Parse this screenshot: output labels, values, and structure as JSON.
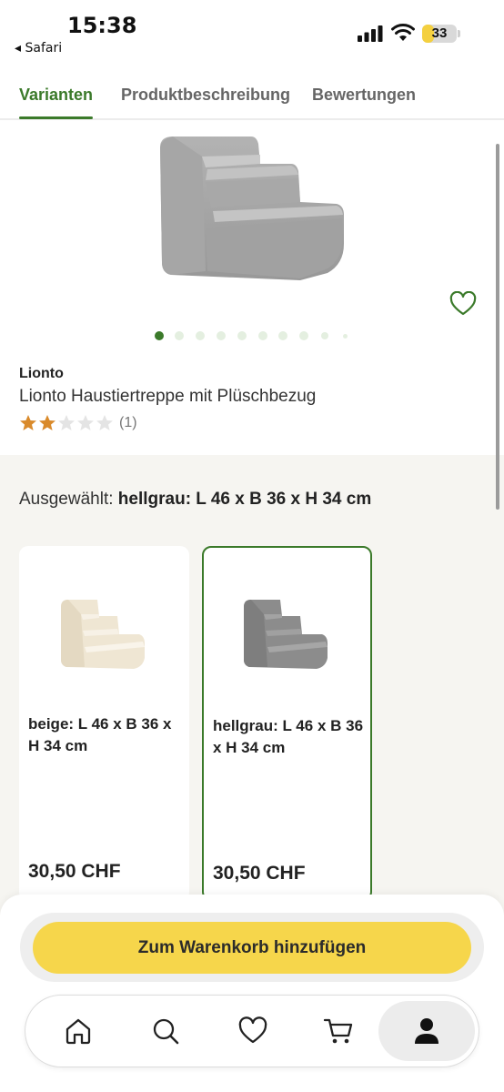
{
  "status_bar": {
    "time": "15:38",
    "back_app": "◂ Safari",
    "battery": "33"
  },
  "tabs": [
    {
      "label": "Varianten",
      "active": true
    },
    {
      "label": "Produktbeschreibung",
      "active": false
    },
    {
      "label": "Bewertungen",
      "active": false
    }
  ],
  "product": {
    "brand": "Lionto",
    "name": "Lionto Haustiertreppe mit Plüschbezug",
    "rating": 2,
    "rating_max": 5,
    "review_count": "(1)",
    "image_count": 10,
    "active_image": 1
  },
  "variants": {
    "selected_label": "Ausgewählt:",
    "selected_value": "hellgrau: L 46 x B 36 x H 34 cm",
    "items": [
      {
        "title": "beige: L 46 x B 36 x H 34 cm",
        "price": "30,50 CHF",
        "selected": false,
        "color": "#efe6d3"
      },
      {
        "title": "hellgrau: L 46 x B 36 x H 34 cm",
        "price": "30,50 CHF",
        "selected": true,
        "color": "#8c8c8c"
      }
    ]
  },
  "cart_button": "Zum Warenkorb hinzufügen",
  "nav": {
    "icons": [
      "home-icon",
      "search-icon",
      "heart-icon",
      "cart-icon",
      "profile-icon"
    ]
  },
  "colors": {
    "accent": "#3b7a2a",
    "button": "#f6d64b",
    "star": "#d98a2b"
  }
}
